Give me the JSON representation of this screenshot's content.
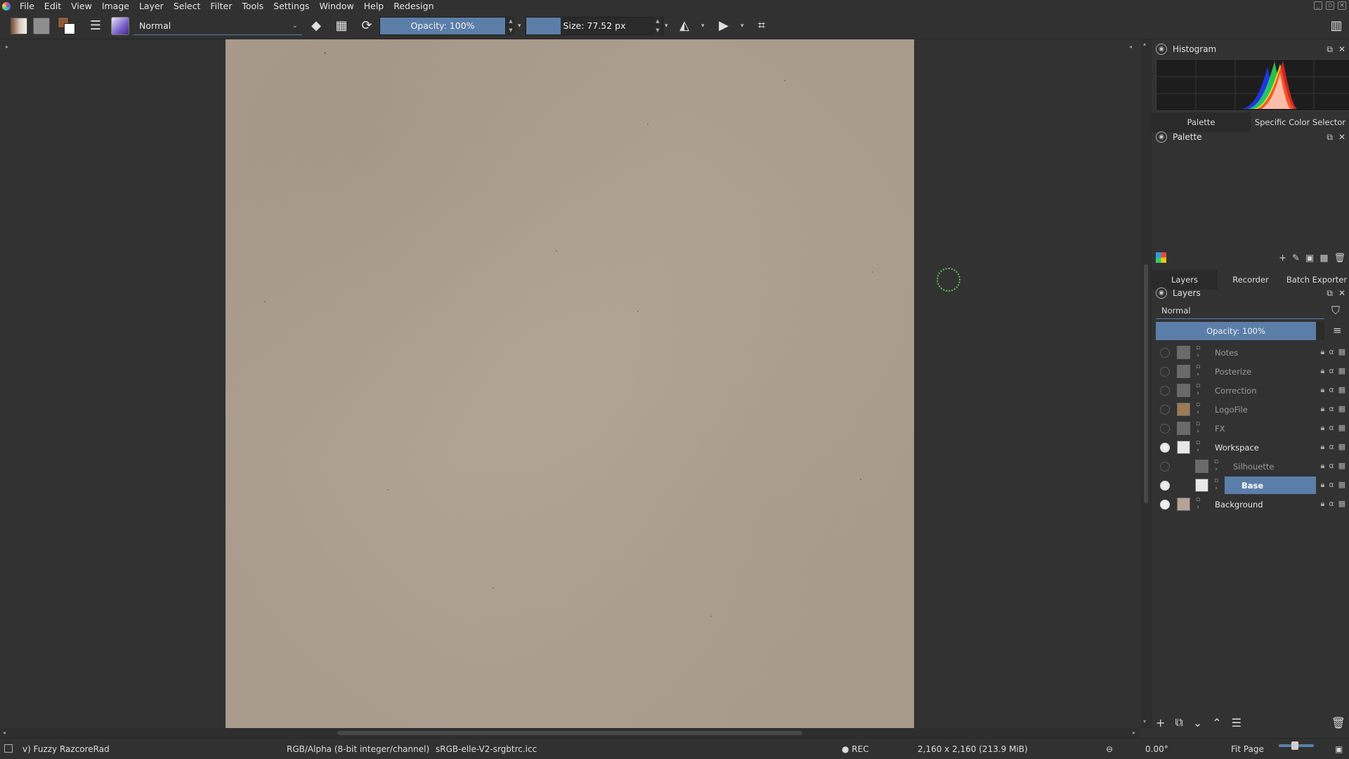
{
  "menubar": {
    "items": [
      "File",
      "Edit",
      "View",
      "Image",
      "Layer",
      "Select",
      "Filter",
      "Tools",
      "Settings",
      "Window",
      "Help",
      "Redesign"
    ]
  },
  "toolbar": {
    "blend_mode": "Normal",
    "opacity_label": "Opacity: 100%",
    "opacity_value": 1.0,
    "size_label": "Size: 77.52 px",
    "size_fill_fraction": 0.25,
    "icons": [
      "gradient-swatch",
      "pattern-swatch",
      "fg-bg-colors",
      "brush-settings-icon",
      "brush-preset",
      "eraser-icon",
      "alpha-lock-icon",
      "reload-icon",
      "mirror-horizontal-icon",
      "mirror-vertical-icon",
      "wrap-around-icon"
    ]
  },
  "dock": {
    "histogram": {
      "title": "Histogram"
    },
    "tabs_top": [
      "Palette",
      "Specific Color Selector"
    ],
    "palette": {
      "title": "Palette"
    },
    "tabs_bottom": [
      "Layers",
      "Recorder",
      "Batch Exporter"
    ],
    "layers": {
      "title": "Layers",
      "blend_mode": "Normal",
      "opacity_label": "Opacity:  100%",
      "items": [
        {
          "name": "Notes",
          "visible": false,
          "child": false,
          "selected": false
        },
        {
          "name": "Posterize",
          "visible": false,
          "child": false,
          "selected": false
        },
        {
          "name": "Correction",
          "visible": false,
          "child": false,
          "selected": false
        },
        {
          "name": "LogoFile",
          "visible": false,
          "child": false,
          "selected": false
        },
        {
          "name": "FX",
          "visible": false,
          "child": false,
          "selected": false
        },
        {
          "name": "Workspace",
          "visible": true,
          "child": false,
          "selected": false
        },
        {
          "name": "Silhouette",
          "visible": false,
          "child": true,
          "selected": false
        },
        {
          "name": "Base",
          "visible": true,
          "child": true,
          "selected": true
        },
        {
          "name": "Background",
          "visible": true,
          "child": false,
          "selected": false
        }
      ]
    }
  },
  "statusbar": {
    "brush_name": "v) Fuzzy RazcoreRad",
    "color_model": "RGB/Alpha (8-bit integer/channel)",
    "profile": "sRGB-elle-V2-srgbtrc.icc",
    "rec": "● REC",
    "image_size": "2,160 x 2,160 (213.9 MiB)",
    "rotation": "0.00°",
    "zoom_mode": "Fit Page"
  },
  "colors": {
    "accent": "#5b7ea8",
    "paper": "#ada192",
    "fg": "#8b5a3c",
    "bg": "#ffffff",
    "brush_cursor": "#5ac85a"
  }
}
